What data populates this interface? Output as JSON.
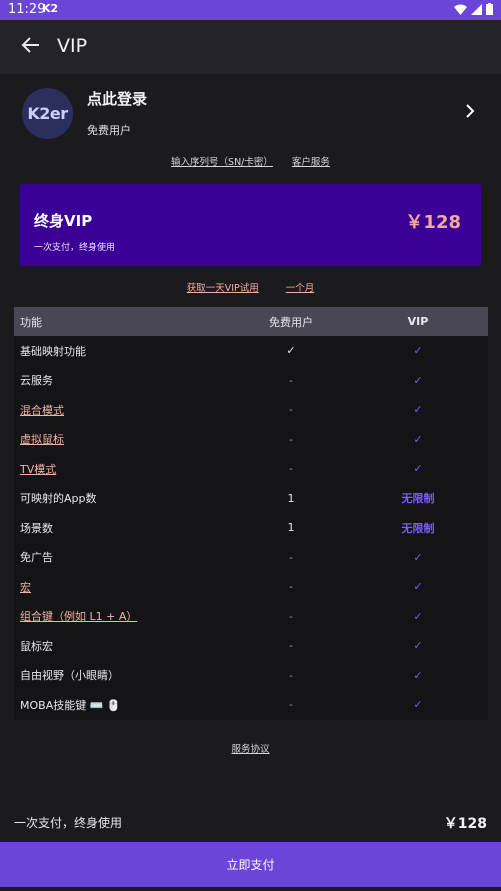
{
  "status": {
    "time": "11:29",
    "app_badge": "K2"
  },
  "appbar": {
    "title": "VIP"
  },
  "user": {
    "avatar_text": "K2er",
    "login": "点此登录",
    "type": "免费用户"
  },
  "links_top": {
    "serial": "输入序列号（SN/卡密）",
    "service": "客户服务"
  },
  "vip_card": {
    "name": "终身VIP",
    "price": "￥128",
    "subtitle": "一次支付，终身使用"
  },
  "links_mid": {
    "trial": "获取一天VIP试用",
    "month": "一个月"
  },
  "table": {
    "headers": [
      "功能",
      "免费用户",
      "VIP"
    ],
    "rows": [
      {
        "feature": "基础映射功能",
        "free": "✓",
        "vip": "✓",
        "link": false
      },
      {
        "feature": "云服务",
        "free": "-",
        "vip": "✓",
        "link": false
      },
      {
        "feature": "混合模式",
        "free": "-",
        "vip": "✓",
        "link": true
      },
      {
        "feature": "虚拟鼠标",
        "free": "-",
        "vip": "✓",
        "link": true
      },
      {
        "feature": "TV模式",
        "free": "-",
        "vip": "✓",
        "link": true
      },
      {
        "feature": "可映射的App数",
        "free": "1",
        "vip": "无限制",
        "link": false
      },
      {
        "feature": "场景数",
        "free": "1",
        "vip": "无限制",
        "link": false
      },
      {
        "feature": "免广告",
        "free": "-",
        "vip": "✓",
        "link": false
      },
      {
        "feature": "宏",
        "free": "-",
        "vip": "✓",
        "link": true
      },
      {
        "feature": "组合键（例如 L1 + A）",
        "free": "-",
        "vip": "✓",
        "link": true
      },
      {
        "feature": "鼠标宏",
        "free": "-",
        "vip": "✓",
        "link": false
      },
      {
        "feature": "自由视野（小眼睛）",
        "free": "-",
        "vip": "✓",
        "link": false
      },
      {
        "feature": "MOBA技能键 ⌨️ 🖱️",
        "free": "-",
        "vip": "✓",
        "link": false
      }
    ]
  },
  "agreement": "服务协议",
  "footer": {
    "text": "一次支付，终身使用",
    "price": "￥128",
    "pay_button": "立即支付"
  },
  "colors": {
    "accent": "#6a45d8",
    "card": "#3b0096",
    "price": "#f3a99a",
    "link": "#f2b3a3",
    "vip_check": "#7b5cff"
  }
}
